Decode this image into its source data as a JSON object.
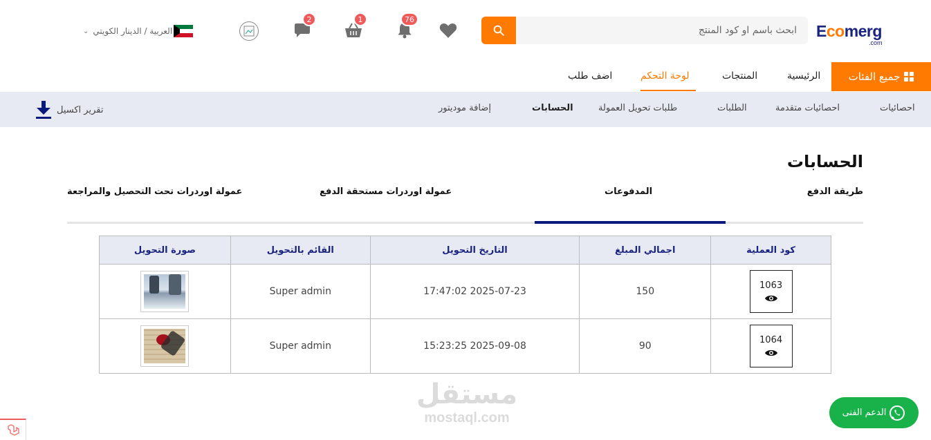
{
  "header": {
    "logo_main_1": "E",
    "logo_main_o": "co",
    "logo_main_2": "merg",
    "logo_sub": ".com",
    "search_placeholder": "ابحث باسم او كود المنتج",
    "icons": {
      "wishlist": "heart-icon",
      "notifications": "bell-icon",
      "cart": "basket-icon",
      "messages": "chat-icon",
      "avatar": "broken-image-icon"
    },
    "notifications_count": "76",
    "cart_count": "1",
    "messages_count": "2",
    "language_currency": "العربية / الدينار الكويتي",
    "accent_color": "#ff7a00"
  },
  "category_nav": {
    "all_categories": "جميع الفئات",
    "links": [
      "الرئيسية",
      "المنتجات",
      "لوحة التحكم",
      "اضف طلب"
    ],
    "active_index": 2
  },
  "sub_nav": {
    "links": [
      "احصائيات",
      "احصائيات متقدمة",
      "الطلبات",
      "طلبات تحويل العمولة",
      "الحسابات",
      "إضافة موديتور"
    ],
    "active_index": 4,
    "excel_report": "تقرير اكسيل"
  },
  "main": {
    "title": "الحسابات",
    "tabs": [
      "طريقة الدفع",
      "المدفوعات",
      "عمولة اوردرات مستحقة الدفع",
      "عمولة اوردرات تحت التحصيل والمراجعة"
    ],
    "active_tab": 1
  },
  "table": {
    "headers": [
      "كود العملية",
      "اجمالي المبلغ",
      "التاريخ التحويل",
      "القائم بالتحويل",
      "صورة التحويل"
    ],
    "rows": [
      {
        "code": "1063",
        "amount": "150",
        "date": "2025-07-23 17:47:02",
        "by": "Super admin"
      },
      {
        "code": "1064",
        "amount": "90",
        "date": "2025-09-08 15:23:25",
        "by": "Super admin"
      }
    ]
  },
  "watermark": {
    "ar": "مستقل",
    "en": "mostaql.com"
  },
  "support": {
    "label": "الدعم الفنى"
  }
}
